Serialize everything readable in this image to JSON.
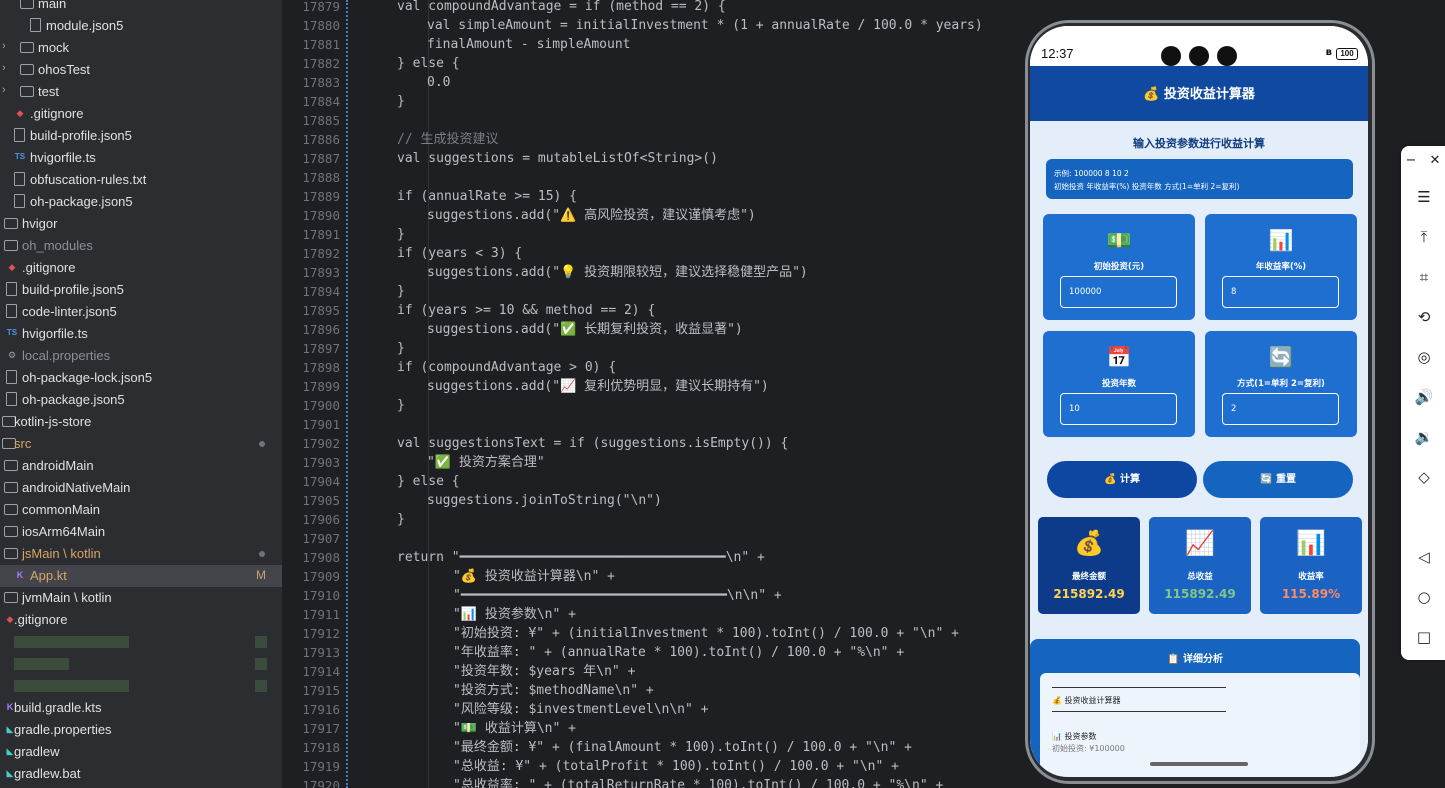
{
  "tree": [
    {
      "label": "main",
      "indent": 38,
      "kind": "folder",
      "arrow": ""
    },
    {
      "label": "module.json5",
      "indent": 46,
      "kind": "file"
    },
    {
      "label": "mock",
      "indent": 38,
      "kind": "folder",
      "arrow": "›"
    },
    {
      "label": "ohosTest",
      "indent": 38,
      "kind": "folder",
      "arrow": "›"
    },
    {
      "label": "test",
      "indent": 38,
      "kind": "folder",
      "arrow": "›"
    },
    {
      "label": ".gitignore",
      "indent": 30,
      "kind": "git"
    },
    {
      "label": "build-profile.json5",
      "indent": 30,
      "kind": "file"
    },
    {
      "label": "hvigorfile.ts",
      "indent": 30,
      "kind": "ts"
    },
    {
      "label": "obfuscation-rules.txt",
      "indent": 30,
      "kind": "file"
    },
    {
      "label": "oh-package.json5",
      "indent": 30,
      "kind": "file"
    },
    {
      "label": "hvigor",
      "indent": 22,
      "kind": "folder"
    },
    {
      "label": "oh_modules",
      "indent": 22,
      "kind": "folder",
      "gray": true
    },
    {
      "label": ".gitignore",
      "indent": 22,
      "kind": "git"
    },
    {
      "label": "build-profile.json5",
      "indent": 22,
      "kind": "file"
    },
    {
      "label": "code-linter.json5",
      "indent": 22,
      "kind": "file"
    },
    {
      "label": "hvigorfile.ts",
      "indent": 22,
      "kind": "ts"
    },
    {
      "label": "local.properties",
      "indent": 22,
      "kind": "gear",
      "gray": true
    },
    {
      "label": "oh-package-lock.json5",
      "indent": 22,
      "kind": "file"
    },
    {
      "label": "oh-package.json5",
      "indent": 22,
      "kind": "file"
    },
    {
      "label": "kotlin-js-store",
      "indent": 14,
      "kind": "folder"
    },
    {
      "label": "src",
      "indent": 14,
      "kind": "folder",
      "orange": true,
      "dot": true
    },
    {
      "label": "androidMain",
      "indent": 22,
      "kind": "folder"
    },
    {
      "label": "androidNativeMain",
      "indent": 22,
      "kind": "folder"
    },
    {
      "label": "commonMain",
      "indent": 22,
      "kind": "folder"
    },
    {
      "label": "iosArm64Main",
      "indent": 22,
      "kind": "folder"
    },
    {
      "label": "jsMain \\ kotlin",
      "indent": 22,
      "kind": "folder",
      "orange": true,
      "dot": true
    },
    {
      "label": "App.kt",
      "indent": 30,
      "kind": "kt",
      "orange": true,
      "sel": true,
      "m": "M"
    },
    {
      "label": "jvmMain \\ kotlin",
      "indent": 22,
      "kind": "folder"
    },
    {
      "label": ".gitignore",
      "indent": 14,
      "kind": "git"
    },
    {
      "label": "",
      "indent": 14,
      "kind": "blur"
    },
    {
      "label": "",
      "indent": 14,
      "kind": "blur"
    },
    {
      "label": "",
      "indent": 14,
      "kind": "blur"
    },
    {
      "label": "build.gradle.kts",
      "indent": 14,
      "kind": "kt"
    },
    {
      "label": "gradle.properties",
      "indent": 14,
      "kind": "grad"
    },
    {
      "label": "gradlew",
      "indent": 14,
      "kind": "grad"
    },
    {
      "label": "gradlew.bat",
      "indent": 14,
      "kind": "grad"
    },
    {
      "label": "line",
      "indent": 0,
      "kind": "none"
    }
  ],
  "code_lines": [
    {
      "n": "17879",
      "t": "val compoundAdvantage = if (method == 2) {",
      "i": 0
    },
    {
      "n": "17880",
      "t": "val simpleAmount = initialInvestment * (1 + annualRate / 100.0 * years)",
      "i": 1
    },
    {
      "n": "17881",
      "t": "finalAmount - simpleAmount",
      "i": 1
    },
    {
      "n": "17882",
      "t": "} else {",
      "i": 0
    },
    {
      "n": "17883",
      "t": "0.0",
      "i": 1
    },
    {
      "n": "17884",
      "t": "}",
      "i": 0
    },
    {
      "n": "17885",
      "t": "",
      "i": 0
    },
    {
      "n": "17886",
      "t": "// 生成投资建议",
      "i": 0,
      "c": "#7a7e85"
    },
    {
      "n": "17887",
      "t": "val suggestions = mutableListOf<String>()",
      "i": 0
    },
    {
      "n": "17888",
      "t": "",
      "i": 0
    },
    {
      "n": "17889",
      "t": "if (annualRate >= 15) {",
      "i": 0
    },
    {
      "n": "17890",
      "t": "suggestions.add(\"⚠️ 高风险投资，建议谨慎考虑\")",
      "i": 1
    },
    {
      "n": "17891",
      "t": "}",
      "i": 0
    },
    {
      "n": "17892",
      "t": "if (years < 3) {",
      "i": 0
    },
    {
      "n": "17893",
      "t": "suggestions.add(\"💡 投资期限较短，建议选择稳健型产品\")",
      "i": 1
    },
    {
      "n": "17894",
      "t": "}",
      "i": 0
    },
    {
      "n": "17895",
      "t": "if (years >= 10 && method == 2) {",
      "i": 0
    },
    {
      "n": "17896",
      "t": "suggestions.add(\"✅ 长期复利投资，收益显著\")",
      "i": 1
    },
    {
      "n": "17897",
      "t": "}",
      "i": 0
    },
    {
      "n": "17898",
      "t": "if (compoundAdvantage > 0) {",
      "i": 0
    },
    {
      "n": "17899",
      "t": "suggestions.add(\"📈 复利优势明显，建议长期持有\")",
      "i": 1
    },
    {
      "n": "17900",
      "t": "}",
      "i": 0
    },
    {
      "n": "17901",
      "t": "",
      "i": 0
    },
    {
      "n": "17902",
      "t": "val suggestionsText = if (suggestions.isEmpty()) {",
      "i": 0
    },
    {
      "n": "17903",
      "t": "\"✅ 投资方案合理\"",
      "i": 1
    },
    {
      "n": "17904",
      "t": "} else {",
      "i": 0
    },
    {
      "n": "17905",
      "t": "suggestions.joinToString(\"\\n\")",
      "i": 1
    },
    {
      "n": "17906",
      "t": "}",
      "i": 0
    },
    {
      "n": "17907",
      "t": "",
      "i": 0
    },
    {
      "n": "17908",
      "t": "return \"━━━━━━━━━━━━━━━━━━━━━━━━━━━━━━━━━━\\n\" +",
      "i": 0
    },
    {
      "n": "17909",
      "t": "\"💰 投资收益计算器\\n\" +",
      "i": 2
    },
    {
      "n": "17910",
      "t": "\"━━━━━━━━━━━━━━━━━━━━━━━━━━━━━━━━━━\\n\\n\" +",
      "i": 2
    },
    {
      "n": "17911",
      "t": "\"📊 投资参数\\n\" +",
      "i": 2
    },
    {
      "n": "17912",
      "t": "\"初始投资: ¥\" + (initialInvestment * 100).toInt() / 100.0 + \"\\n\" +",
      "i": 2
    },
    {
      "n": "17913",
      "t": "\"年收益率: \" + (annualRate * 100).toInt() / 100.0 + \"%\\n\" +",
      "i": 2
    },
    {
      "n": "17914",
      "t": "\"投资年数: $years 年\\n\" +",
      "i": 2
    },
    {
      "n": "17915",
      "t": "\"投资方式: $methodName\\n\" +",
      "i": 2
    },
    {
      "n": "17916",
      "t": "\"风险等级: $investmentLevel\\n\\n\" +",
      "i": 2
    },
    {
      "n": "17917",
      "t": "\"💵 收益计算\\n\" +",
      "i": 2
    },
    {
      "n": "17918",
      "t": "\"最终金额: ¥\" + (finalAmount * 100).toInt() / 100.0 + \"\\n\" +",
      "i": 2
    },
    {
      "n": "17919",
      "t": "\"总收益: ¥\" + (totalProfit * 100).toInt() / 100.0 + \"\\n\" +",
      "i": 2
    },
    {
      "n": "17920",
      "t": "\"总收益率: \" + (totalReturnRate * 100).toInt() / 100.0 + \"%\\n\" +",
      "i": 2
    }
  ],
  "phone": {
    "time": "12:37",
    "battery": "100",
    "bt": "ʙ",
    "title": "💰 投资收益计算器",
    "subtitle": "输入投资参数进行收益计算",
    "hint_line1": "示例: 100000 8 10 2",
    "hint_line2": "初始投资 年收益率(%) 投资年数 方式(1=单利 2=复利)",
    "fields": [
      {
        "icon": "💵",
        "label": "初始投资(元)",
        "value": "100000"
      },
      {
        "icon": "📊",
        "label": "年收益率(%)",
        "value": "8"
      },
      {
        "icon": "📅",
        "label": "投资年数",
        "value": "10"
      },
      {
        "icon": "🔄",
        "label": "方式(1=单利 2=复利)",
        "value": "2"
      }
    ],
    "calc_button": "💰 计算",
    "reset_button": "🔄 重置",
    "results": [
      {
        "icon": "💰",
        "label": "最终金额",
        "value": "215892.49",
        "color": "#ffd54f"
      },
      {
        "icon": "📈",
        "label": "总收益",
        "value": "115892.49",
        "color": "#81c784"
      },
      {
        "icon": "📊",
        "label": "收益率",
        "value": "115.89%",
        "color": "#ff8a65"
      }
    ],
    "detail_title": "📋 详细分析",
    "detail_line1": "💰 投资收益计算器",
    "detail_line2": "📊 投资参数",
    "detail_line3": "初始投资: ¥100000"
  },
  "right_toolbar": [
    "−",
    "✕",
    "☰",
    "⤒",
    "⌗",
    "⟲",
    "◎",
    "🔊",
    "🔉",
    "◇",
    "◁",
    "○",
    "□"
  ]
}
